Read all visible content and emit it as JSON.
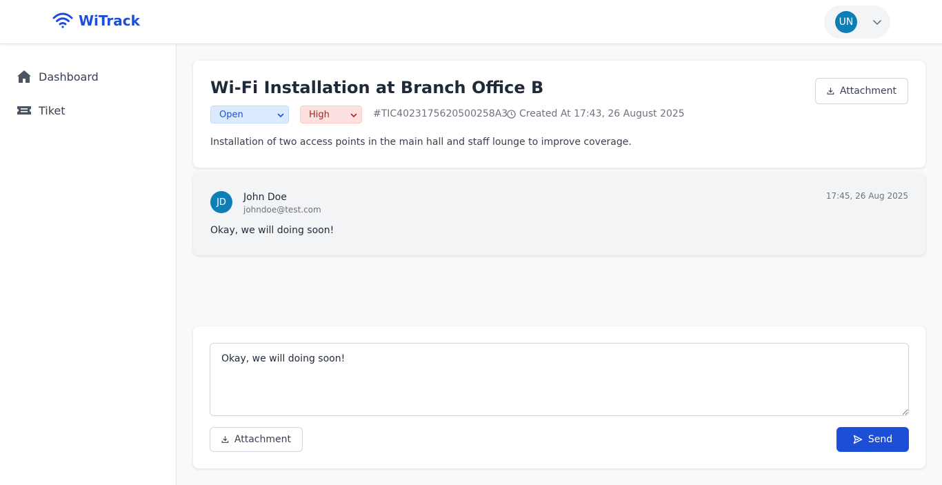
{
  "app": {
    "name": "WiTrack"
  },
  "user": {
    "initials": "UN"
  },
  "sidebar": {
    "items": [
      {
        "label": "Dashboard",
        "icon": "home-icon"
      },
      {
        "label": "Tiket",
        "icon": "ticket-icon"
      }
    ]
  },
  "ticket": {
    "title": "Wi-Fi Installation at Branch Office B",
    "status": "Open",
    "priority": "High",
    "id": "#TIC4023175620500258A3",
    "created": "Created At 17:43, 26 August 2025",
    "description": "Installation of two access points in the main hall and staff lounge to improve coverage.",
    "attachment_label": "Attachment"
  },
  "comments": [
    {
      "initials": "JD",
      "name": "John Doe",
      "email": "johndoe@test.com",
      "time": "17:45, 26 Aug 2025",
      "text": "Okay, we will doing soon!"
    }
  ],
  "reply": {
    "value": "Okay, we will doing soon!",
    "attachment_label": "Attachment",
    "send_label": "Send"
  },
  "colors": {
    "primary": "#1d4ed8",
    "avatar": "#0e7fb5",
    "status_bg": "#dbeafe",
    "priority_bg": "#fde0e0"
  }
}
